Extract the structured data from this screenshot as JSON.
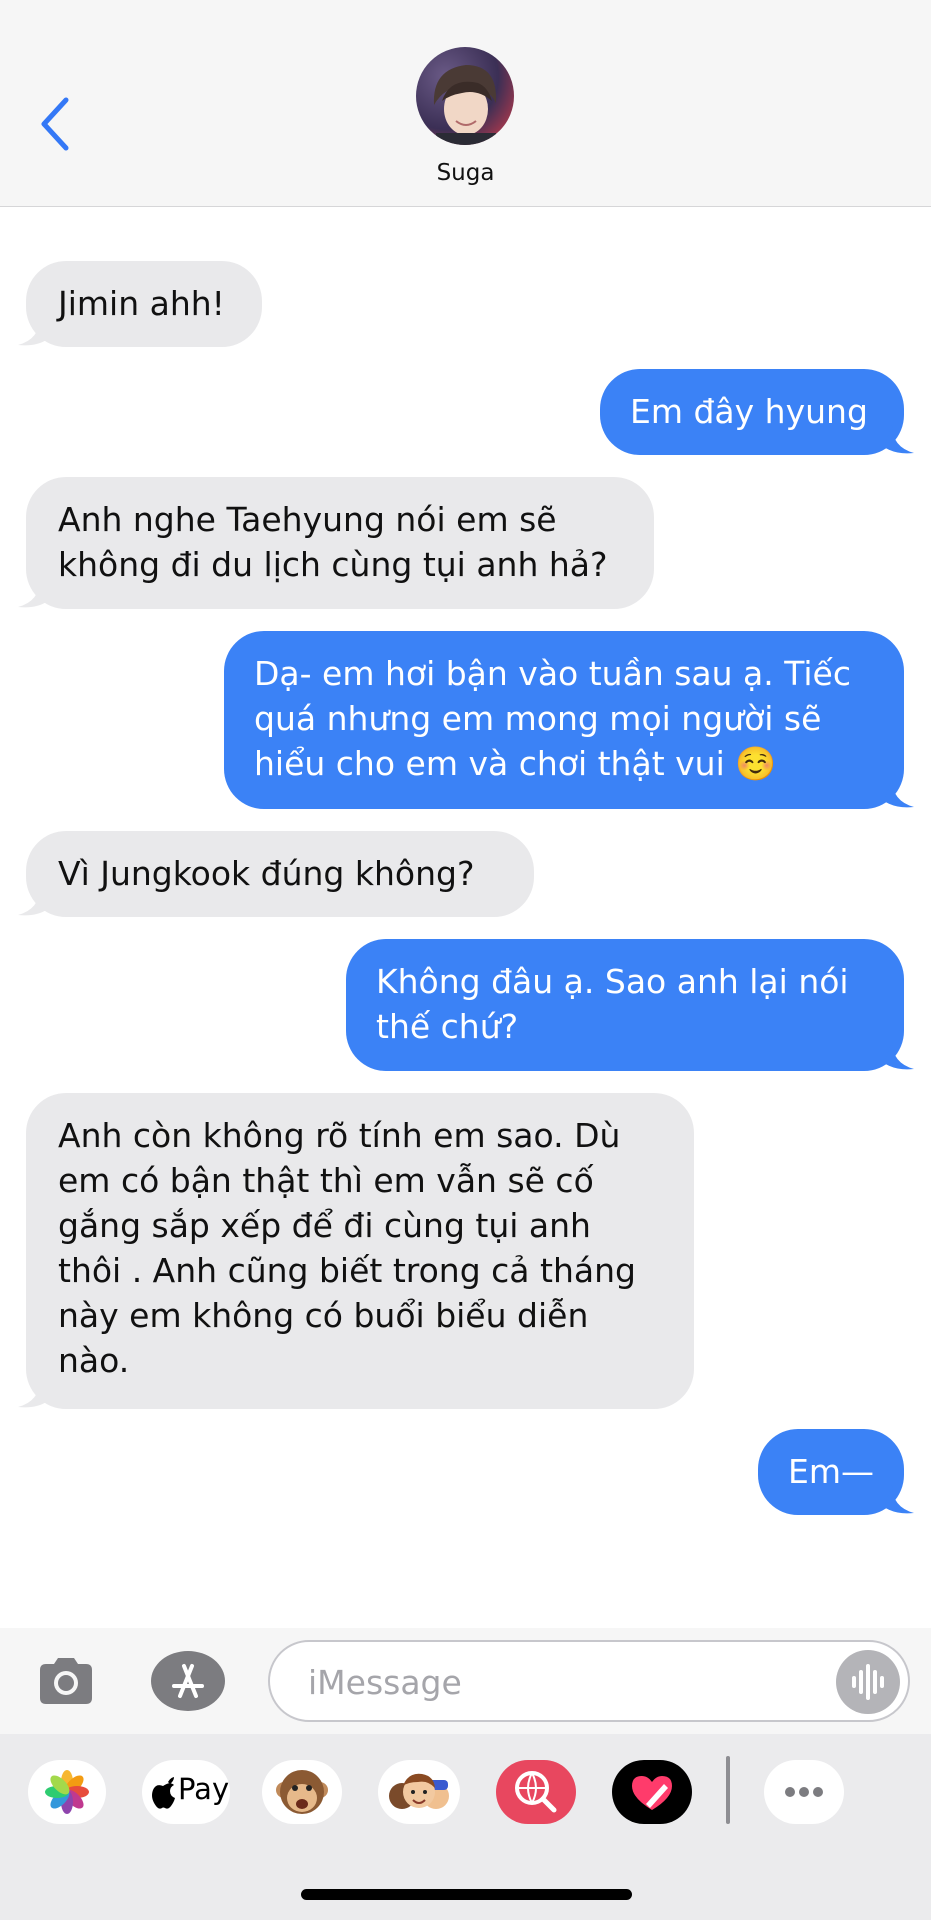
{
  "header": {
    "back_label": "",
    "contact_name": "Suga"
  },
  "messages": [
    {
      "direction": "in",
      "text": "Jimin ahh!"
    },
    {
      "direction": "out",
      "text": "Em đây hyung"
    },
    {
      "direction": "in",
      "text": "Anh nghe Taehyung nói em sẽ\nkhông đi du lịch cùng tụi anh hả?"
    },
    {
      "direction": "out",
      "text": "Dạ- em hơi bận vào tuần sau ạ. Tiếc\nquá nhưng em mong mọi người sẽ\nhiểu cho em và chơi thật vui ☺️"
    },
    {
      "direction": "in",
      "text": "Vì Jungkook đúng không?"
    },
    {
      "direction": "out",
      "text": "Không đâu ạ. Sao anh lại nói\nthế chứ?"
    },
    {
      "direction": "in",
      "text": "Anh còn không rõ tính em sao. Dù\nem có bận thật thì em vẫn sẽ cố\ngắng sắp xếp để đi cùng tụi anh\nthôi . Anh cũng biết trong cả tháng\nnày em không có buổi biểu diễn\nnào."
    },
    {
      "direction": "out",
      "text": "Em—"
    }
  ],
  "input": {
    "placeholder": "iMessage",
    "value": ""
  },
  "app_drawer": {
    "apple_pay_label": "Pay"
  },
  "colors": {
    "outgoing_bubble": "#3b82f6",
    "incoming_bubble": "#e9e9eb",
    "accent": "#3b82f6"
  }
}
